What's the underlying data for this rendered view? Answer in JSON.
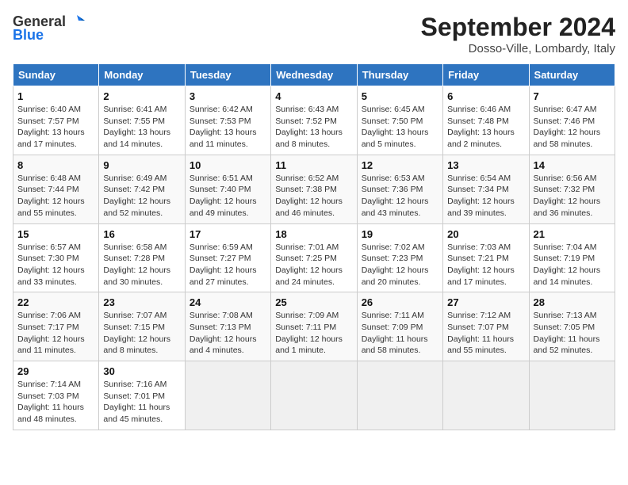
{
  "logo": {
    "line1": "General",
    "line2": "Blue"
  },
  "title": "September 2024",
  "subtitle": "Dosso-Ville, Lombardy, Italy",
  "headers": [
    "Sunday",
    "Monday",
    "Tuesday",
    "Wednesday",
    "Thursday",
    "Friday",
    "Saturday"
  ],
  "weeks": [
    [
      {
        "day": "1",
        "sunrise": "6:40 AM",
        "sunset": "7:57 PM",
        "daylight": "13 hours and 17 minutes."
      },
      {
        "day": "2",
        "sunrise": "6:41 AM",
        "sunset": "7:55 PM",
        "daylight": "13 hours and 14 minutes."
      },
      {
        "day": "3",
        "sunrise": "6:42 AM",
        "sunset": "7:53 PM",
        "daylight": "13 hours and 11 minutes."
      },
      {
        "day": "4",
        "sunrise": "6:43 AM",
        "sunset": "7:52 PM",
        "daylight": "13 hours and 8 minutes."
      },
      {
        "day": "5",
        "sunrise": "6:45 AM",
        "sunset": "7:50 PM",
        "daylight": "13 hours and 5 minutes."
      },
      {
        "day": "6",
        "sunrise": "6:46 AM",
        "sunset": "7:48 PM",
        "daylight": "13 hours and 2 minutes."
      },
      {
        "day": "7",
        "sunrise": "6:47 AM",
        "sunset": "7:46 PM",
        "daylight": "12 hours and 58 minutes."
      }
    ],
    [
      {
        "day": "8",
        "sunrise": "6:48 AM",
        "sunset": "7:44 PM",
        "daylight": "12 hours and 55 minutes."
      },
      {
        "day": "9",
        "sunrise": "6:49 AM",
        "sunset": "7:42 PM",
        "daylight": "12 hours and 52 minutes."
      },
      {
        "day": "10",
        "sunrise": "6:51 AM",
        "sunset": "7:40 PM",
        "daylight": "12 hours and 49 minutes."
      },
      {
        "day": "11",
        "sunrise": "6:52 AM",
        "sunset": "7:38 PM",
        "daylight": "12 hours and 46 minutes."
      },
      {
        "day": "12",
        "sunrise": "6:53 AM",
        "sunset": "7:36 PM",
        "daylight": "12 hours and 43 minutes."
      },
      {
        "day": "13",
        "sunrise": "6:54 AM",
        "sunset": "7:34 PM",
        "daylight": "12 hours and 39 minutes."
      },
      {
        "day": "14",
        "sunrise": "6:56 AM",
        "sunset": "7:32 PM",
        "daylight": "12 hours and 36 minutes."
      }
    ],
    [
      {
        "day": "15",
        "sunrise": "6:57 AM",
        "sunset": "7:30 PM",
        "daylight": "12 hours and 33 minutes."
      },
      {
        "day": "16",
        "sunrise": "6:58 AM",
        "sunset": "7:28 PM",
        "daylight": "12 hours and 30 minutes."
      },
      {
        "day": "17",
        "sunrise": "6:59 AM",
        "sunset": "7:27 PM",
        "daylight": "12 hours and 27 minutes."
      },
      {
        "day": "18",
        "sunrise": "7:01 AM",
        "sunset": "7:25 PM",
        "daylight": "12 hours and 24 minutes."
      },
      {
        "day": "19",
        "sunrise": "7:02 AM",
        "sunset": "7:23 PM",
        "daylight": "12 hours and 20 minutes."
      },
      {
        "day": "20",
        "sunrise": "7:03 AM",
        "sunset": "7:21 PM",
        "daylight": "12 hours and 17 minutes."
      },
      {
        "day": "21",
        "sunrise": "7:04 AM",
        "sunset": "7:19 PM",
        "daylight": "12 hours and 14 minutes."
      }
    ],
    [
      {
        "day": "22",
        "sunrise": "7:06 AM",
        "sunset": "7:17 PM",
        "daylight": "12 hours and 11 minutes."
      },
      {
        "day": "23",
        "sunrise": "7:07 AM",
        "sunset": "7:15 PM",
        "daylight": "12 hours and 8 minutes."
      },
      {
        "day": "24",
        "sunrise": "7:08 AM",
        "sunset": "7:13 PM",
        "daylight": "12 hours and 4 minutes."
      },
      {
        "day": "25",
        "sunrise": "7:09 AM",
        "sunset": "7:11 PM",
        "daylight": "12 hours and 1 minute."
      },
      {
        "day": "26",
        "sunrise": "7:11 AM",
        "sunset": "7:09 PM",
        "daylight": "11 hours and 58 minutes."
      },
      {
        "day": "27",
        "sunrise": "7:12 AM",
        "sunset": "7:07 PM",
        "daylight": "11 hours and 55 minutes."
      },
      {
        "day": "28",
        "sunrise": "7:13 AM",
        "sunset": "7:05 PM",
        "daylight": "11 hours and 52 minutes."
      }
    ],
    [
      {
        "day": "29",
        "sunrise": "7:14 AM",
        "sunset": "7:03 PM",
        "daylight": "11 hours and 48 minutes."
      },
      {
        "day": "30",
        "sunrise": "7:16 AM",
        "sunset": "7:01 PM",
        "daylight": "11 hours and 45 minutes."
      },
      null,
      null,
      null,
      null,
      null
    ]
  ]
}
